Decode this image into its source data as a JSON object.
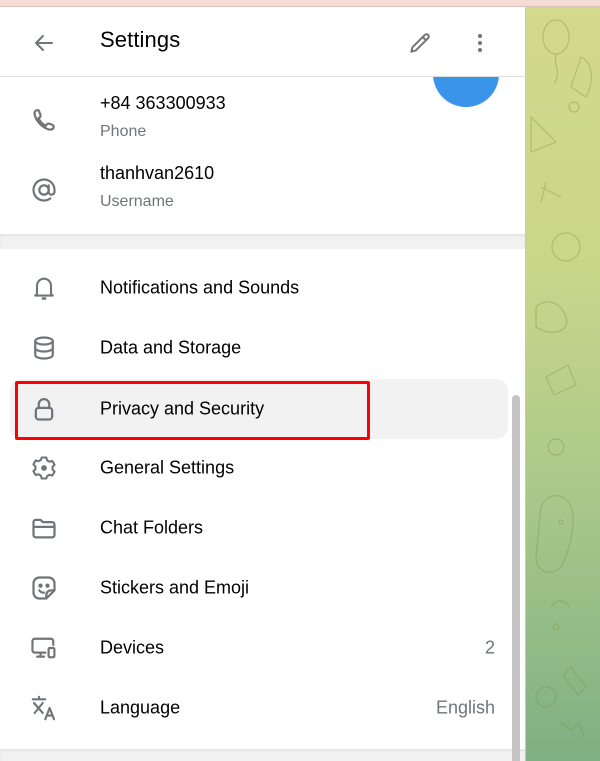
{
  "header": {
    "title": "Settings",
    "back_icon": "arrow-left-icon",
    "edit_icon": "pencil-icon",
    "more_icon": "more-vertical-icon"
  },
  "fab": {
    "icon": "add-photo-icon",
    "color": "#3a95ea"
  },
  "profile_info": [
    {
      "icon": "phone-icon",
      "value": "+84 363300933",
      "label": "Phone"
    },
    {
      "icon": "at-sign-icon",
      "value": "thanhvan2610",
      "label": "Username"
    }
  ],
  "menu": [
    {
      "icon": "bell-icon",
      "label": "Notifications and Sounds",
      "value": ""
    },
    {
      "icon": "database-icon",
      "label": "Data and Storage",
      "value": ""
    },
    {
      "icon": "lock-icon",
      "label": "Privacy and Security",
      "value": "",
      "active": true
    },
    {
      "icon": "gear-icon",
      "label": "General Settings",
      "value": ""
    },
    {
      "icon": "folder-icon",
      "label": "Chat Folders",
      "value": ""
    },
    {
      "icon": "sticker-icon",
      "label": "Stickers and Emoji",
      "value": ""
    },
    {
      "icon": "devices-icon",
      "label": "Devices",
      "value": "2"
    },
    {
      "icon": "translate-icon",
      "label": "Language",
      "value": "English"
    }
  ],
  "annotation": {
    "highlighted_item": "Privacy and Security",
    "color": "#ff0000"
  },
  "colors": {
    "icon_gray": "#707579",
    "secondary_text": "#707579",
    "active_row_bg": "#f2f2f2"
  }
}
